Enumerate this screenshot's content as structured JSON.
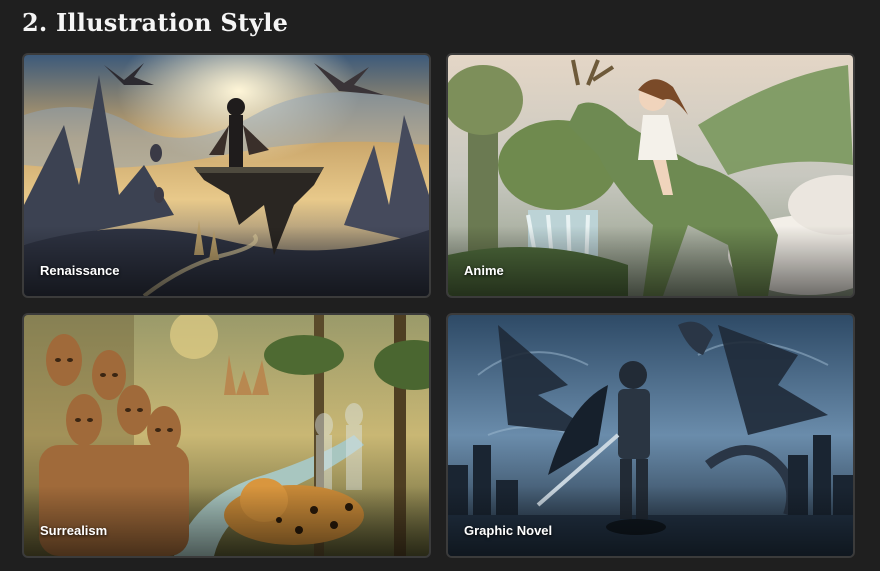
{
  "section": {
    "title": "2. Illustration Style"
  },
  "cards": [
    {
      "label": "Renaissance"
    },
    {
      "label": "Anime"
    },
    {
      "label": "Surrealism"
    },
    {
      "label": "Graphic Novel"
    }
  ],
  "colors": {
    "background": "#1f1f1f",
    "card_border": "#3b3b3b",
    "text": "#ffffff"
  }
}
